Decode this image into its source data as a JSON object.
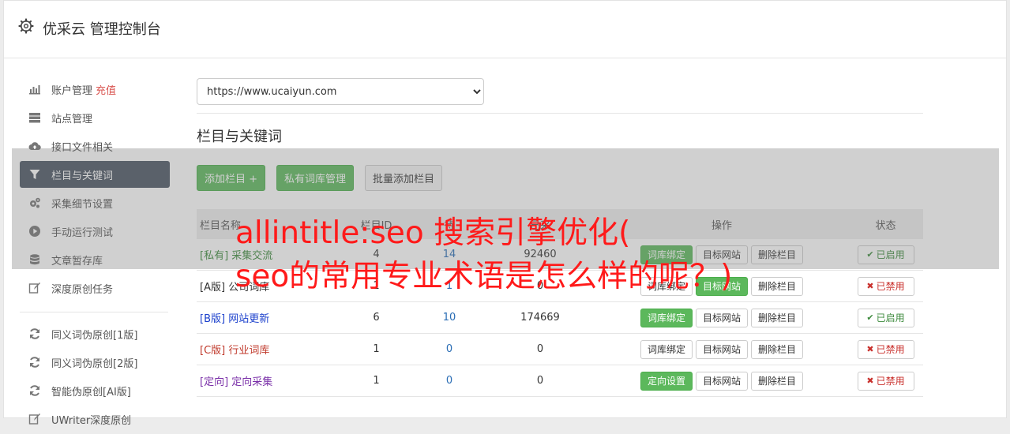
{
  "header": {
    "title": "优采云 管理控制台"
  },
  "sidebar": {
    "items": [
      {
        "label": "账户管理",
        "extra": "充值",
        "icon": "bar-chart-icon"
      },
      {
        "label": "站点管理",
        "icon": "server-icon"
      },
      {
        "label": "接口文件相关",
        "icon": "cloud-upload-icon"
      },
      {
        "label": "栏目与关键词",
        "icon": "filter-icon",
        "active": true
      },
      {
        "label": "采集细节设置",
        "icon": "cogs-icon"
      },
      {
        "label": "手动运行测试",
        "icon": "play-circle-icon"
      },
      {
        "label": "文章暂存库",
        "icon": "database-icon"
      },
      {
        "label": "深度原创任务",
        "icon": "edit-icon"
      }
    ],
    "items2": [
      {
        "label": "同义词伪原创[1版]",
        "icon": "refresh-icon"
      },
      {
        "label": "同义词伪原创[2版]",
        "icon": "refresh-icon"
      },
      {
        "label": "智能伪原创[AI版]",
        "icon": "refresh-icon"
      },
      {
        "label": "UWriter深度原创",
        "icon": "edit-icon"
      }
    ]
  },
  "main": {
    "site_select": "https://www.ucaiyun.com",
    "section_title": "栏目与关键词",
    "buttons": {
      "add": "添加栏目 +",
      "private_lib": "私有词库管理",
      "batch_add": "批量添加栏目"
    },
    "table": {
      "headers": {
        "name": "栏目名称",
        "id": "栏目ID",
        "pending": "待",
        "done": "已采",
        "ops": "操作",
        "status": "状态"
      },
      "rows": [
        {
          "tag": "[私有]",
          "name": "采集交流",
          "id": "4",
          "pending": "14",
          "done": "92460",
          "op1": "词库绑定",
          "op2": "目标网站",
          "op3": "删除栏目",
          "status": "已启用"
        },
        {
          "tag": "[A版]",
          "name": "公司词库",
          "id": "1",
          "pending": "1",
          "done": "0",
          "op1": "词库绑定",
          "op2": "目标网站",
          "op3": "删除栏目",
          "status": "已禁用"
        },
        {
          "tag": "[B版]",
          "name": "网站更新",
          "id": "6",
          "pending": "10",
          "done": "174669",
          "op1": "词库绑定",
          "op2": "目标网站",
          "op3": "删除栏目",
          "status": "已启用"
        },
        {
          "tag": "[C版]",
          "name": "行业词库",
          "id": "1",
          "pending": "0",
          "done": "0",
          "op1": "词库绑定",
          "op2": "目标网站",
          "op3": "删除栏目",
          "status": "已禁用"
        },
        {
          "tag": "[定向]",
          "name": "定向采集",
          "id": "1",
          "pending": "0",
          "done": "0",
          "op1": "定向设置",
          "op2": "目标网站",
          "op3": "删除栏目",
          "status": "已禁用"
        }
      ]
    }
  },
  "overlay": {
    "line1": "allintitle:seo 搜索引擎优化(",
    "line2": "seo的常用专业术语是怎么样的呢？)"
  },
  "colors": {
    "accent_green": "#5cb85c",
    "sidebar_active": "#4a5563",
    "overlay_text": "#ff1a1a"
  }
}
